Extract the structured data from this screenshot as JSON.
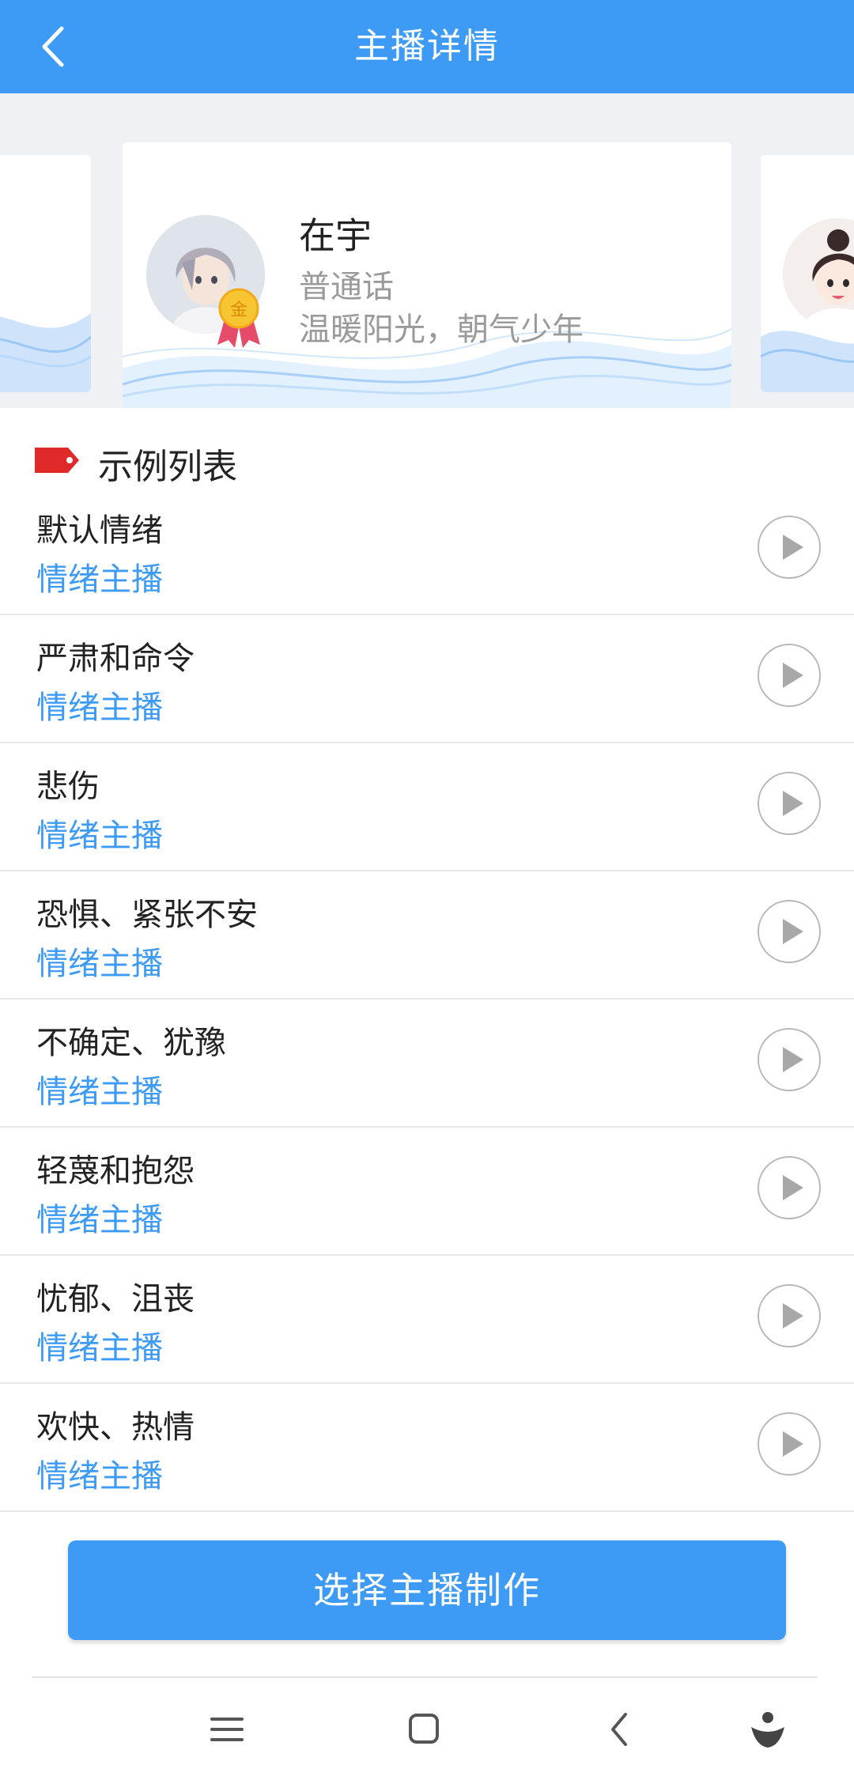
{
  "header": {
    "title": "主播详情",
    "back_icon": "chevron-left-icon"
  },
  "anchor": {
    "name": "在宇",
    "language": "普通话",
    "description": "温暖阳光，朝气少年",
    "medal_text": "金"
  },
  "section": {
    "title": "示例列表",
    "icon": "tag-icon",
    "icon_color": "#e02a2a"
  },
  "samples": [
    {
      "name": "默认情绪",
      "type": "情绪主播"
    },
    {
      "name": "严肃和命令",
      "type": "情绪主播"
    },
    {
      "name": "悲伤",
      "type": "情绪主播"
    },
    {
      "name": "恐惧、紧张不安",
      "type": "情绪主播"
    },
    {
      "name": "不确定、犹豫",
      "type": "情绪主播"
    },
    {
      "name": "轻蔑和抱怨",
      "type": "情绪主播"
    },
    {
      "name": "忧郁、沮丧",
      "type": "情绪主播"
    },
    {
      "name": "欢快、热情",
      "type": "情绪主播"
    }
  ],
  "cta": {
    "label": "选择主播制作"
  },
  "colors": {
    "accent": "#3d9bf5",
    "background": "#f0f1f5",
    "tag": "#e02a2a"
  },
  "nav": [
    "menu-icon",
    "home-square-icon",
    "back-chevron-icon",
    "assistant-icon"
  ]
}
